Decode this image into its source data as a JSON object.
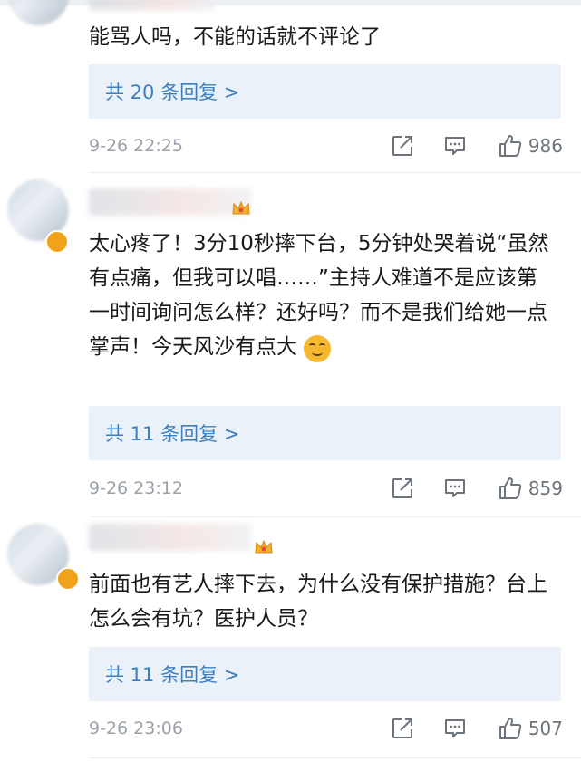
{
  "comments": [
    {
      "text": "能骂人吗，不能的话就不评论了",
      "replies_label": "共 20 条回复 >",
      "time": "9-26 22:25",
      "likes": "986"
    },
    {
      "text": "太心疼了！3分10秒摔下台，5分钟处哭着说“虽然有点痛，但我可以唱……”主持人难道不是应该第一时间询问怎么样？还好吗？而不是我们给她一点掌声！今天风沙有点大",
      "replies_label": "共 11 条回复 >",
      "time": "9-26 23:12",
      "likes": "859"
    },
    {
      "text": "前面也有艺人摔下去，为什么没有保护措施？台上怎么会有坑？医护人员？",
      "replies_label": "共 11 条回复 >",
      "time": "9-26 23:06",
      "likes": "507"
    }
  ],
  "colors": {
    "link": "#3c7fc0",
    "reply_bg": "#eaf1f8",
    "meta": "#9aa1a8",
    "icon": "#6d747b"
  },
  "icons": [
    "share-icon",
    "comment-icon",
    "thumbs-up-icon",
    "upside-down-face-icon",
    "crown-icon"
  ]
}
